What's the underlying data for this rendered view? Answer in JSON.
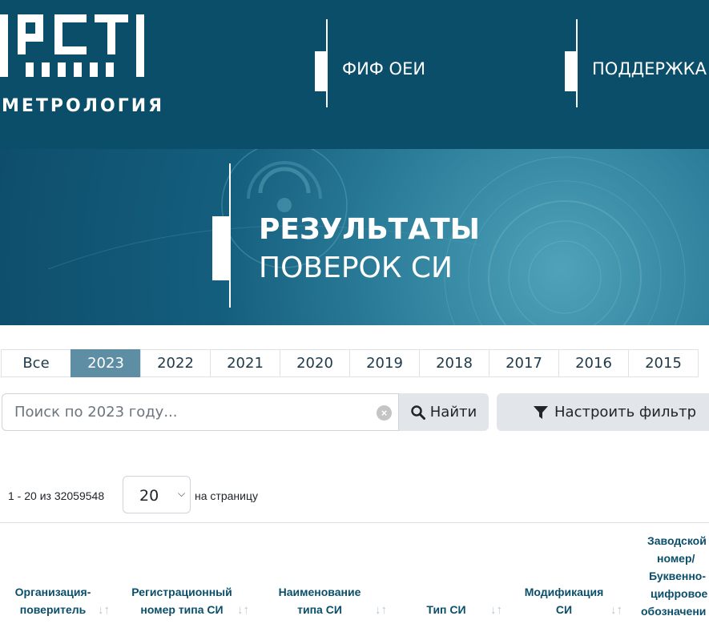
{
  "header": {
    "logo_text": "МЕТРОЛОГИЯ",
    "logo_mark": "РСТ",
    "nav": [
      {
        "label": "ФИФ ОЕИ"
      },
      {
        "label": "ПОДДЕРЖКА"
      }
    ]
  },
  "banner": {
    "title_line1": "РЕЗУЛЬТАТЫ",
    "title_line2": "ПОВЕРОК СИ"
  },
  "year_tabs": [
    "Все",
    "2023",
    "2022",
    "2021",
    "2020",
    "2019",
    "2018",
    "2017",
    "2016",
    "2015"
  ],
  "active_year": "2023",
  "search": {
    "placeholder": "Поиск по 2023 году...",
    "find_label": "Найти",
    "filter_label": "Настроить фильтр"
  },
  "pagination": {
    "range_text": "1 - 20 из 32059548",
    "per_page_value": "20",
    "per_page_label": "на страницу"
  },
  "table": {
    "columns": [
      {
        "label_l1": "Организация-",
        "label_l2": "поверитель"
      },
      {
        "label_l1": "Регистрационный",
        "label_l2": "номер типа СИ"
      },
      {
        "label_l1": "Наименование",
        "label_l2": "типа СИ"
      },
      {
        "label_l1": "",
        "label_l2": "Тип СИ"
      },
      {
        "label_l1": "Модификация",
        "label_l2": "СИ"
      },
      {
        "label_l1": "Заводской",
        "label_l2": "номер/",
        "label_l3": "Буквенно-",
        "label_l4": "цифровое",
        "label_l5": "обозначени"
      }
    ],
    "sort_glyph": "↓↑"
  },
  "colors": {
    "brand": "#0b4e6a",
    "active_tab": "#5e8ea3",
    "button_bg": "#e2e6ea"
  }
}
